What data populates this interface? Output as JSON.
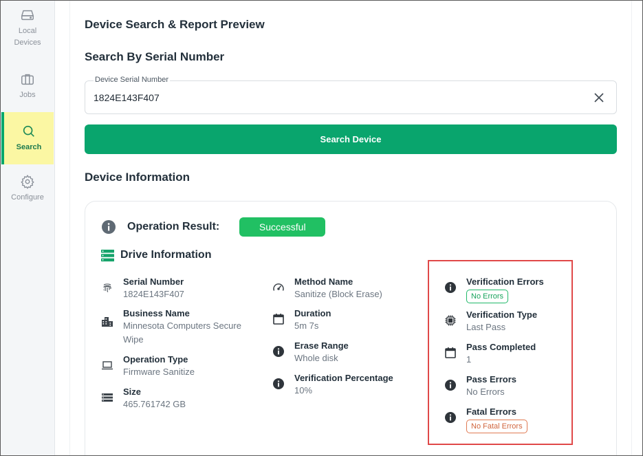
{
  "sidebar": {
    "items": [
      {
        "label_line1": "Local",
        "label_line2": "Devices",
        "icon": "hard-drive-icon"
      },
      {
        "label": "Jobs",
        "icon": "briefcase-icon"
      },
      {
        "label": "Search",
        "icon": "search-icon",
        "active": true
      },
      {
        "label": "Configure",
        "icon": "gear-icon"
      }
    ],
    "active_color": "#07a86b",
    "active_bg": "#fbf7a3"
  },
  "page": {
    "title": "Device Search & Report Preview",
    "search_section_title": "Search By Serial Number",
    "device_section_title": "Device Information"
  },
  "search": {
    "field_label": "Device Serial Number",
    "value": "1824E143F407",
    "button_label": "Search Device",
    "button_color": "#09a56d"
  },
  "result": {
    "label": "Operation Result:",
    "status": "Successful",
    "status_color": "#21c063"
  },
  "drive": {
    "title": "Drive Information",
    "column1": [
      {
        "name": "Serial Number",
        "value": "1824E143F407",
        "icon": "fingerprint-icon"
      },
      {
        "name": "Business Name",
        "value_line1": "Minnesota Computers Secure",
        "value_line2": "Wipe",
        "icon": "building-icon"
      },
      {
        "name": "Operation Type",
        "value": "Firmware Sanitize",
        "icon": "laptop-icon"
      },
      {
        "name": "Size",
        "value": "465.761742 GB",
        "icon": "storage-icon"
      }
    ],
    "column2": [
      {
        "name": "Method Name",
        "value": "Sanitize (Block Erase)",
        "icon": "speedometer-icon"
      },
      {
        "name": "Duration",
        "value": "5m 7s",
        "icon": "calendar-icon"
      },
      {
        "name": "Erase Range",
        "value": "Whole disk",
        "icon": "info-icon"
      },
      {
        "name": "Verification Percentage",
        "value": "10%",
        "icon": "info-icon"
      }
    ],
    "column3": [
      {
        "name": "Verification Errors",
        "badge": "No Errors",
        "icon": "info-icon"
      },
      {
        "name": "Verification Type",
        "value": "Last Pass",
        "icon": "chip-icon"
      },
      {
        "name": "Pass Completed",
        "value": "1",
        "icon": "calendar-icon"
      },
      {
        "name": "Pass Errors",
        "value": "No Errors",
        "icon": "info-icon"
      },
      {
        "name": "Fatal Errors",
        "badge": "No Fatal Errors",
        "icon": "info-icon"
      }
    ]
  }
}
